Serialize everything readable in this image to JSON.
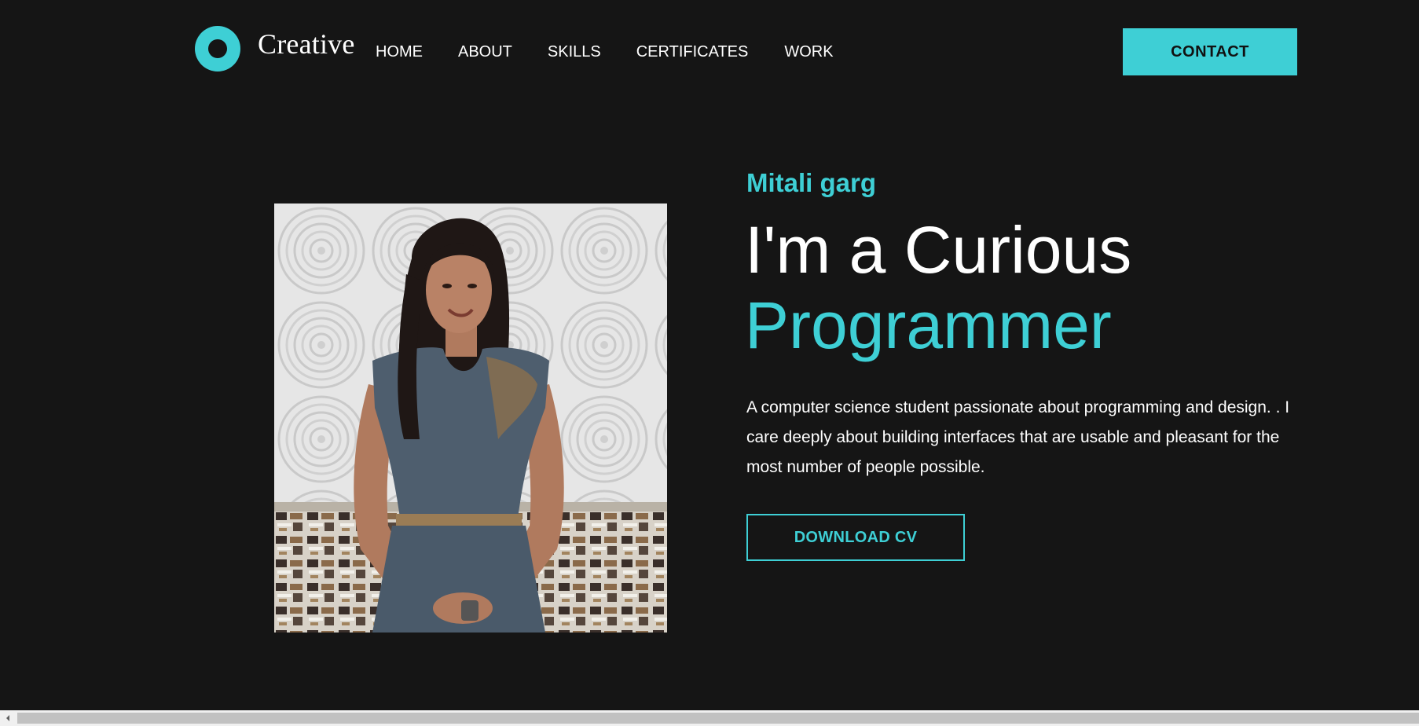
{
  "header": {
    "logo_text": "Creative",
    "nav": {
      "home": "HOME",
      "about": "ABOUT",
      "skills": "SKILLS",
      "certificates": "CERTIFICATES",
      "work": "WORK"
    },
    "contact_label": "CONTACT"
  },
  "hero": {
    "name": "Mitali garg",
    "headline_line1": "I'm a Curious",
    "headline_line2": "Programmer",
    "description": "A computer science student passionate about programming and design. . I care deeply about building interfaces that are usable and pleasant for the most number of people possible.",
    "download_label": "DOWNLOAD CV",
    "photo_alt": "Portrait"
  },
  "colors": {
    "accent": "#3ecfd5",
    "background": "#151515",
    "text": "#ffffff"
  },
  "icons": {
    "logo": "ring-logo-icon",
    "scroll_left": "chevron-left-icon"
  }
}
